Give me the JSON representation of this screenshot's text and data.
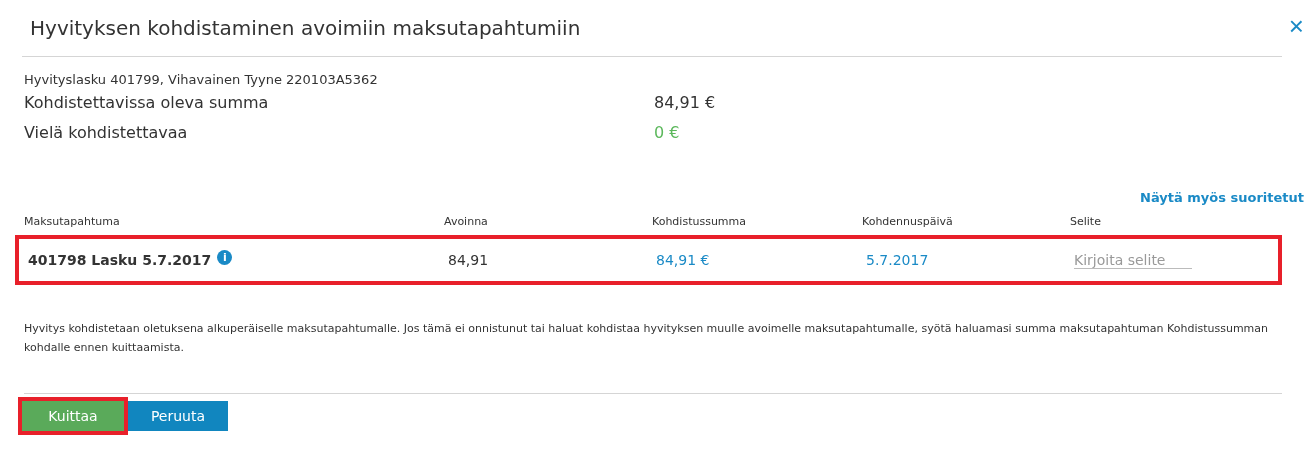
{
  "dialog": {
    "title": "Hyvityksen kohdistaminen avoimiin maksutapahtumiin",
    "close": "×"
  },
  "invoice_line": "Hyvityslasku 401799, Vihavainen Tyyne 220103A5362",
  "summary": [
    {
      "label": "Kohdistettavissa oleva summa",
      "value": "84,91 €",
      "kind": "plain"
    },
    {
      "label": "Vielä kohdistettavaa",
      "value": "0 €",
      "kind": "positive"
    }
  ],
  "show_completed_link": "Näytä myös suoritetut",
  "table": {
    "columns": [
      "Maksutapahtuma",
      "Avoinna",
      "Kohdistussumma",
      "Kohdennuspäivä",
      "Selite"
    ],
    "rows": [
      {
        "transaction": "401798 Lasku 5.7.2017",
        "info": "i",
        "open": "84,91",
        "amount": "84,91 €",
        "date": "5.7.2017",
        "note_placeholder": "Kirjoita selite",
        "highlighted": true
      }
    ]
  },
  "help_text": "Hyvitys kohdistetaan oletuksena alkuperäiselle maksutapahtumalle. Jos tämä ei onnistunut tai haluat kohdistaa hyvityksen muulle avoimelle maksutapahtumalle, syötä haluamasi summa maksutapahtuman Kohdistussumman kohdalle ennen kuittaamista.",
  "buttons": [
    {
      "label": "Kuittaa",
      "kind": "primary",
      "highlighted": true
    },
    {
      "label": "Peruuta",
      "kind": "secondary",
      "highlighted": false
    }
  ]
}
